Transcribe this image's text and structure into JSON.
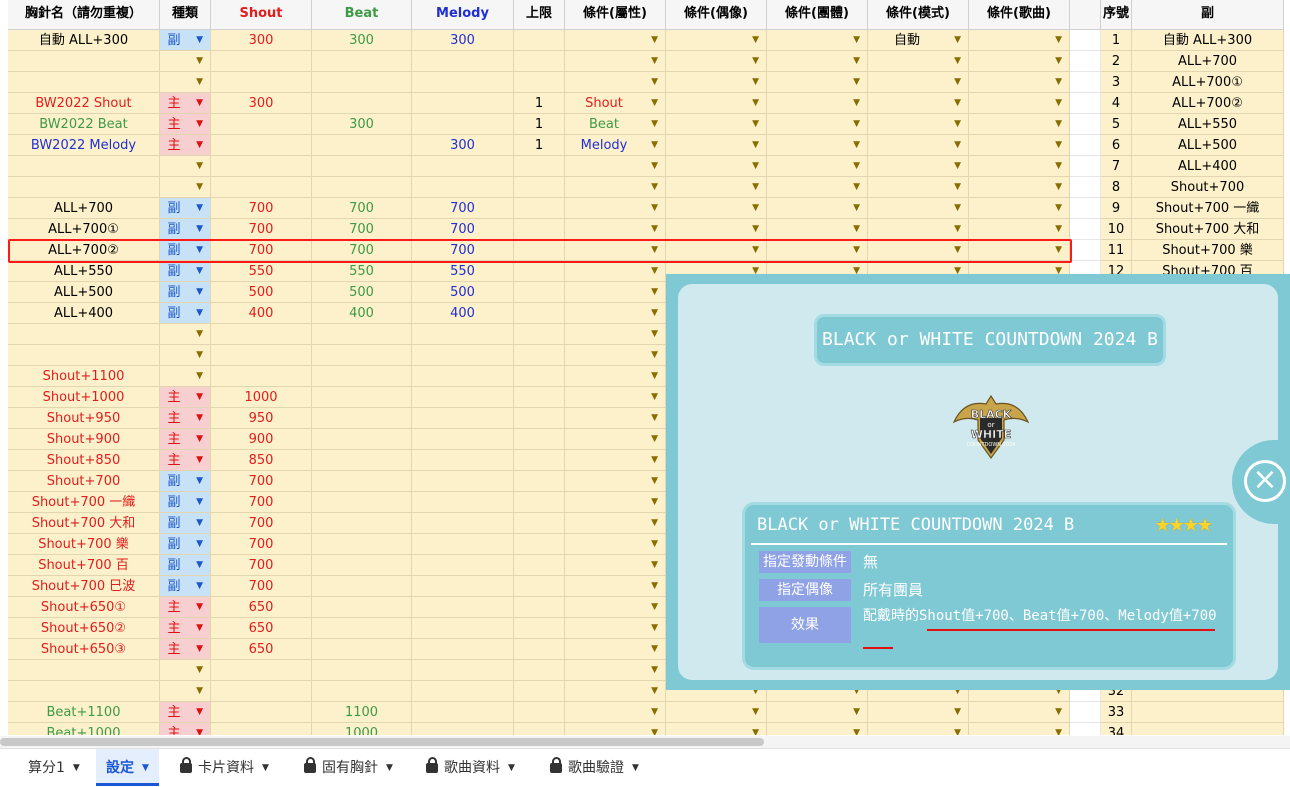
{
  "headers": [
    "胸針名（請勿重複）",
    "種類",
    "Shout",
    "Beat",
    "Melody",
    "上限",
    "條件(屬性)",
    "條件(偶像)",
    "條件(團體)",
    "條件(模式)",
    "條件(歌曲)",
    "",
    "序號",
    "副"
  ],
  "rows": [
    {
      "name": "自動 ALL+300",
      "nc": "black",
      "type": "副",
      "shout": "300",
      "beat": "300",
      "melody": "300",
      "limit": "",
      "attr": "",
      "mode": "自動",
      "idx": "1",
      "sub": "自動 ALL+300"
    },
    {
      "name": "",
      "nc": "black",
      "type": "",
      "shout": "",
      "beat": "",
      "melody": "",
      "limit": "",
      "attr": "",
      "mode": "",
      "idx": "2",
      "sub": "ALL+700"
    },
    {
      "name": "",
      "nc": "black",
      "type": "",
      "shout": "",
      "beat": "",
      "melody": "",
      "limit": "",
      "attr": "",
      "mode": "",
      "idx": "3",
      "sub": "ALL+700①"
    },
    {
      "name": "BW2022 Shout",
      "nc": "red",
      "type": "主",
      "shout": "300",
      "beat": "",
      "melody": "",
      "limit": "1",
      "attr": "Shout",
      "attrc": "red",
      "mode": "",
      "idx": "4",
      "sub": "ALL+700②"
    },
    {
      "name": "BW2022 Beat",
      "nc": "green",
      "type": "主",
      "shout": "",
      "beat": "300",
      "melody": "",
      "limit": "1",
      "attr": "Beat",
      "attrc": "green",
      "mode": "",
      "idx": "5",
      "sub": "ALL+550"
    },
    {
      "name": "BW2022 Melody",
      "nc": "blue",
      "type": "主",
      "shout": "",
      "beat": "",
      "melody": "300",
      "limit": "1",
      "attr": "Melody",
      "attrc": "blue",
      "mode": "",
      "idx": "6",
      "sub": "ALL+500"
    },
    {
      "name": "",
      "nc": "black",
      "type": "",
      "shout": "",
      "beat": "",
      "melody": "",
      "limit": "",
      "attr": "",
      "mode": "",
      "idx": "7",
      "sub": "ALL+400"
    },
    {
      "name": "",
      "nc": "black",
      "type": "",
      "shout": "",
      "beat": "",
      "melody": "",
      "limit": "",
      "attr": "",
      "mode": "",
      "idx": "8",
      "sub": "Shout+700"
    },
    {
      "name": "ALL+700",
      "nc": "black",
      "type": "副",
      "shout": "700",
      "beat": "700",
      "melody": "700",
      "limit": "",
      "attr": "",
      "mode": "",
      "idx": "9",
      "sub": "Shout+700 一織"
    },
    {
      "name": "ALL+700①",
      "nc": "black",
      "type": "副",
      "shout": "700",
      "beat": "700",
      "melody": "700",
      "limit": "",
      "attr": "",
      "mode": "",
      "idx": "10",
      "sub": "Shout+700 大和"
    },
    {
      "name": "ALL+700②",
      "nc": "black",
      "type": "副",
      "shout": "700",
      "beat": "700",
      "melody": "700",
      "limit": "",
      "attr": "",
      "mode": "",
      "idx": "11",
      "sub": "Shout+700 樂"
    },
    {
      "name": "ALL+550",
      "nc": "black",
      "type": "副",
      "shout": "550",
      "beat": "550",
      "melody": "550",
      "limit": "",
      "attr": "",
      "mode": "",
      "idx": "12",
      "sub": "Shout+700 百"
    },
    {
      "name": "ALL+500",
      "nc": "black",
      "type": "副",
      "shout": "500",
      "beat": "500",
      "melody": "500",
      "limit": "",
      "attr": "",
      "mode": "",
      "idx": "",
      "sub": ""
    },
    {
      "name": "ALL+400",
      "nc": "black",
      "type": "副",
      "shout": "400",
      "beat": "400",
      "melody": "400",
      "limit": "",
      "attr": "",
      "mode": "",
      "idx": "",
      "sub": ""
    },
    {
      "name": "",
      "nc": "black",
      "type": "",
      "shout": "",
      "beat": "",
      "melody": "",
      "limit": "",
      "attr": "",
      "mode": "",
      "idx": "",
      "sub": ""
    },
    {
      "name": "",
      "nc": "black",
      "type": "",
      "shout": "",
      "beat": "",
      "melody": "",
      "limit": "",
      "attr": "",
      "mode": "",
      "idx": "",
      "sub": ""
    },
    {
      "name": "Shout+1100",
      "nc": "red",
      "type": "",
      "shout": "",
      "beat": "",
      "melody": "",
      "limit": "",
      "attr": "",
      "mode": "",
      "idx": "",
      "sub": ""
    },
    {
      "name": "Shout+1000",
      "nc": "red",
      "type": "主",
      "shout": "1000",
      "beat": "",
      "melody": "",
      "limit": "",
      "attr": "",
      "mode": "",
      "idx": "",
      "sub": ""
    },
    {
      "name": "Shout+950",
      "nc": "red",
      "type": "主",
      "shout": "950",
      "beat": "",
      "melody": "",
      "limit": "",
      "attr": "",
      "mode": "",
      "idx": "",
      "sub": ""
    },
    {
      "name": "Shout+900",
      "nc": "red",
      "type": "主",
      "shout": "900",
      "beat": "",
      "melody": "",
      "limit": "",
      "attr": "",
      "mode": "",
      "idx": "",
      "sub": ""
    },
    {
      "name": "Shout+850",
      "nc": "red",
      "type": "主",
      "shout": "850",
      "beat": "",
      "melody": "",
      "limit": "",
      "attr": "",
      "mode": "",
      "idx": "",
      "sub": ""
    },
    {
      "name": "Shout+700",
      "nc": "red",
      "type": "副",
      "shout": "700",
      "beat": "",
      "melody": "",
      "limit": "",
      "attr": "",
      "mode": "",
      "idx": "",
      "sub": ""
    },
    {
      "name": "Shout+700 一織",
      "nc": "red",
      "type": "副",
      "shout": "700",
      "beat": "",
      "melody": "",
      "limit": "",
      "attr": "",
      "mode": "",
      "idx": "",
      "sub": ""
    },
    {
      "name": "Shout+700 大和",
      "nc": "red",
      "type": "副",
      "shout": "700",
      "beat": "",
      "melody": "",
      "limit": "",
      "attr": "",
      "mode": "",
      "idx": "",
      "sub": ""
    },
    {
      "name": "Shout+700 樂",
      "nc": "red",
      "type": "副",
      "shout": "700",
      "beat": "",
      "melody": "",
      "limit": "",
      "attr": "",
      "mode": "",
      "idx": "",
      "sub": ""
    },
    {
      "name": "Shout+700 百",
      "nc": "red",
      "type": "副",
      "shout": "700",
      "beat": "",
      "melody": "",
      "limit": "",
      "attr": "",
      "mode": "",
      "idx": "",
      "sub": ""
    },
    {
      "name": "Shout+700 巳波",
      "nc": "red",
      "type": "副",
      "shout": "700",
      "beat": "",
      "melody": "",
      "limit": "",
      "attr": "",
      "mode": "",
      "idx": "",
      "sub": ""
    },
    {
      "name": "Shout+650①",
      "nc": "red",
      "type": "主",
      "shout": "650",
      "beat": "",
      "melody": "",
      "limit": "",
      "attr": "",
      "mode": "",
      "idx": "",
      "sub": ""
    },
    {
      "name": "Shout+650②",
      "nc": "red",
      "type": "主",
      "shout": "650",
      "beat": "",
      "melody": "",
      "limit": "",
      "attr": "",
      "mode": "",
      "idx": "",
      "sub": ""
    },
    {
      "name": "Shout+650③",
      "nc": "red",
      "type": "主",
      "shout": "650",
      "beat": "",
      "melody": "",
      "limit": "",
      "attr": "",
      "mode": "",
      "idx": "",
      "sub": ""
    },
    {
      "name": "",
      "nc": "black",
      "type": "",
      "shout": "",
      "beat": "",
      "melody": "",
      "limit": "",
      "attr": "",
      "mode": "",
      "idx": "",
      "sub": ""
    },
    {
      "name": "",
      "nc": "black",
      "type": "",
      "shout": "",
      "beat": "",
      "melody": "",
      "limit": "",
      "attr": "",
      "mode": "",
      "idx": "32",
      "sub": ""
    },
    {
      "name": "Beat+1100",
      "nc": "green",
      "type": "主",
      "shout": "",
      "beat": "1100",
      "melody": "",
      "limit": "",
      "attr": "",
      "mode": "",
      "idx": "33",
      "sub": ""
    },
    {
      "name": "Beat+1000",
      "nc": "green",
      "type": "主",
      "shout": "",
      "beat": "1000",
      "melody": "",
      "limit": "",
      "attr": "",
      "mode": "",
      "idx": "34",
      "sub": ""
    }
  ],
  "popup": {
    "title": "BLACK or WHITE COUNTDOWN 2024 B",
    "logo_text_1": "BLACK",
    "logo_text_2": "or",
    "logo_text_3": "WHITE",
    "logo_text_4": "COUNTDOWN 2024",
    "card_title": "BLACK or WHITE COUNTDOWN 2024 B",
    "stars": "★★★★",
    "k1": "指定發動條件",
    "v1": "無",
    "k2": "指定偶像",
    "v2": "所有團員",
    "k3": "效果",
    "v3": "配戴時的Shout值+700、Beat值+700、Melody值+700",
    "close": "×"
  },
  "tabs": [
    {
      "label": "算分1",
      "locked": false,
      "active": false
    },
    {
      "label": "設定",
      "locked": false,
      "active": true
    },
    {
      "label": "卡片資料",
      "locked": true,
      "active": false
    },
    {
      "label": "固有胸針",
      "locked": true,
      "active": false
    },
    {
      "label": "歌曲資料",
      "locked": true,
      "active": false
    },
    {
      "label": "歌曲驗證",
      "locked": true,
      "active": false
    }
  ],
  "colors": {
    "red": "#e21d1d",
    "green": "#3d9a47",
    "blue": "#1f2fd4",
    "accent": "#1a57d6",
    "popup": "#7fc9d4"
  }
}
